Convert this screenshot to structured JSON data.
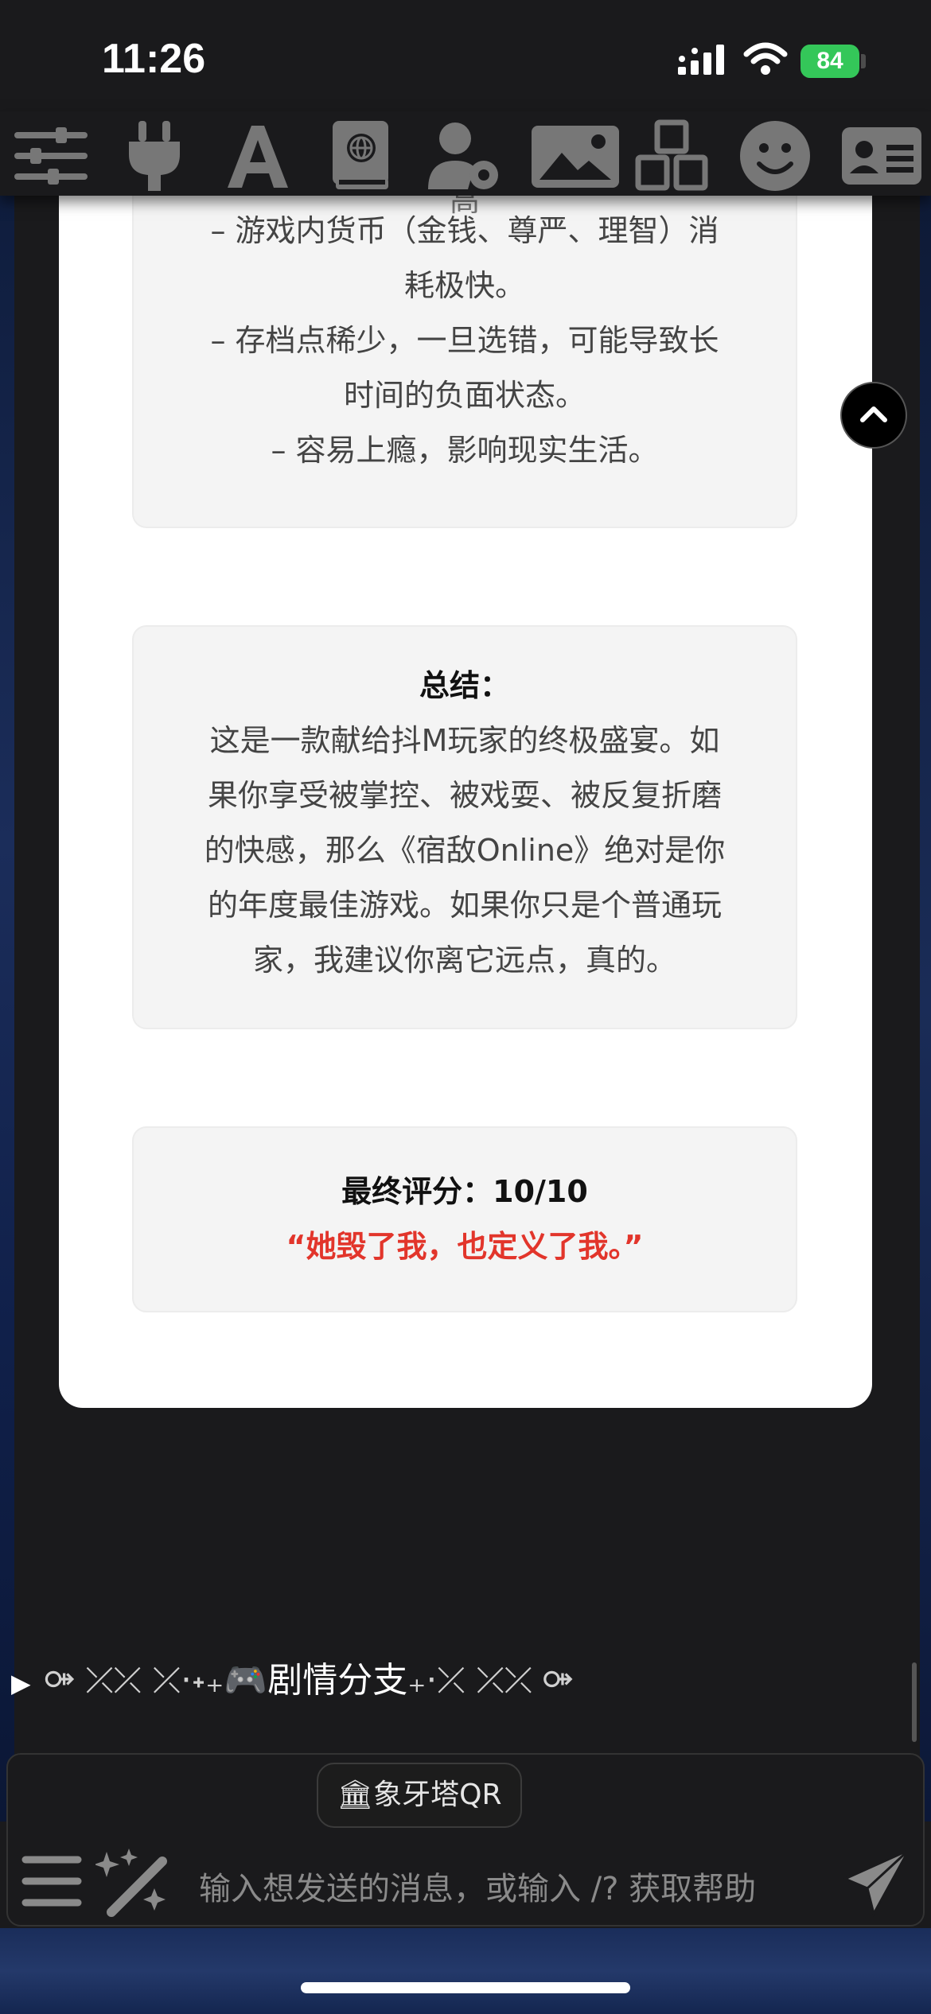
{
  "status_bar": {
    "time": "11:26",
    "battery": "84"
  },
  "toolbar": {
    "icons": [
      "sliders-icon",
      "plug-icon",
      "font-icon",
      "book-globe-icon",
      "user-gear-icon",
      "image-icon",
      "cubes-icon",
      "smiley-icon",
      "id-card-icon"
    ]
  },
  "review": {
    "cut_text": "高",
    "cons": [
      "– 游戏内货币（金钱、尊严、理智）消",
      "耗极快。",
      "– 存档点稀少，一旦选错，可能导致长",
      "时间的负面状态。",
      "– 容易上瘾，影响现实生活。"
    ],
    "summary_title": "总结：",
    "summary_lines": [
      "这是一款献给抖M玩家的终极盛宴。如",
      "果你享受被掌控、被戏耍、被反复折磨",
      "的快感，那么《宿敌Online》绝对是你",
      "的年度最佳游戏。如果你只是个普通玩",
      "家，我建议你离它远点，真的。"
    ],
    "score_title": "最终评分：10/10",
    "score_quote": "“她毁了我，也定义了我。”"
  },
  "branch_toggle": {
    "deco_left": "⚩ ⤫⤫ ⤫·˖₊",
    "emoji": "🎮",
    "label": "剧情分支",
    "deco_right": "₊·⤫ ⤫⤫ ⚩"
  },
  "composer": {
    "qr_button": "🏛象牙塔QR",
    "placeholder": "输入想发送的消息，或输入 /? 获取帮助"
  },
  "colors": {
    "accent_red": "#e2352b",
    "battery_green": "#34c759"
  }
}
